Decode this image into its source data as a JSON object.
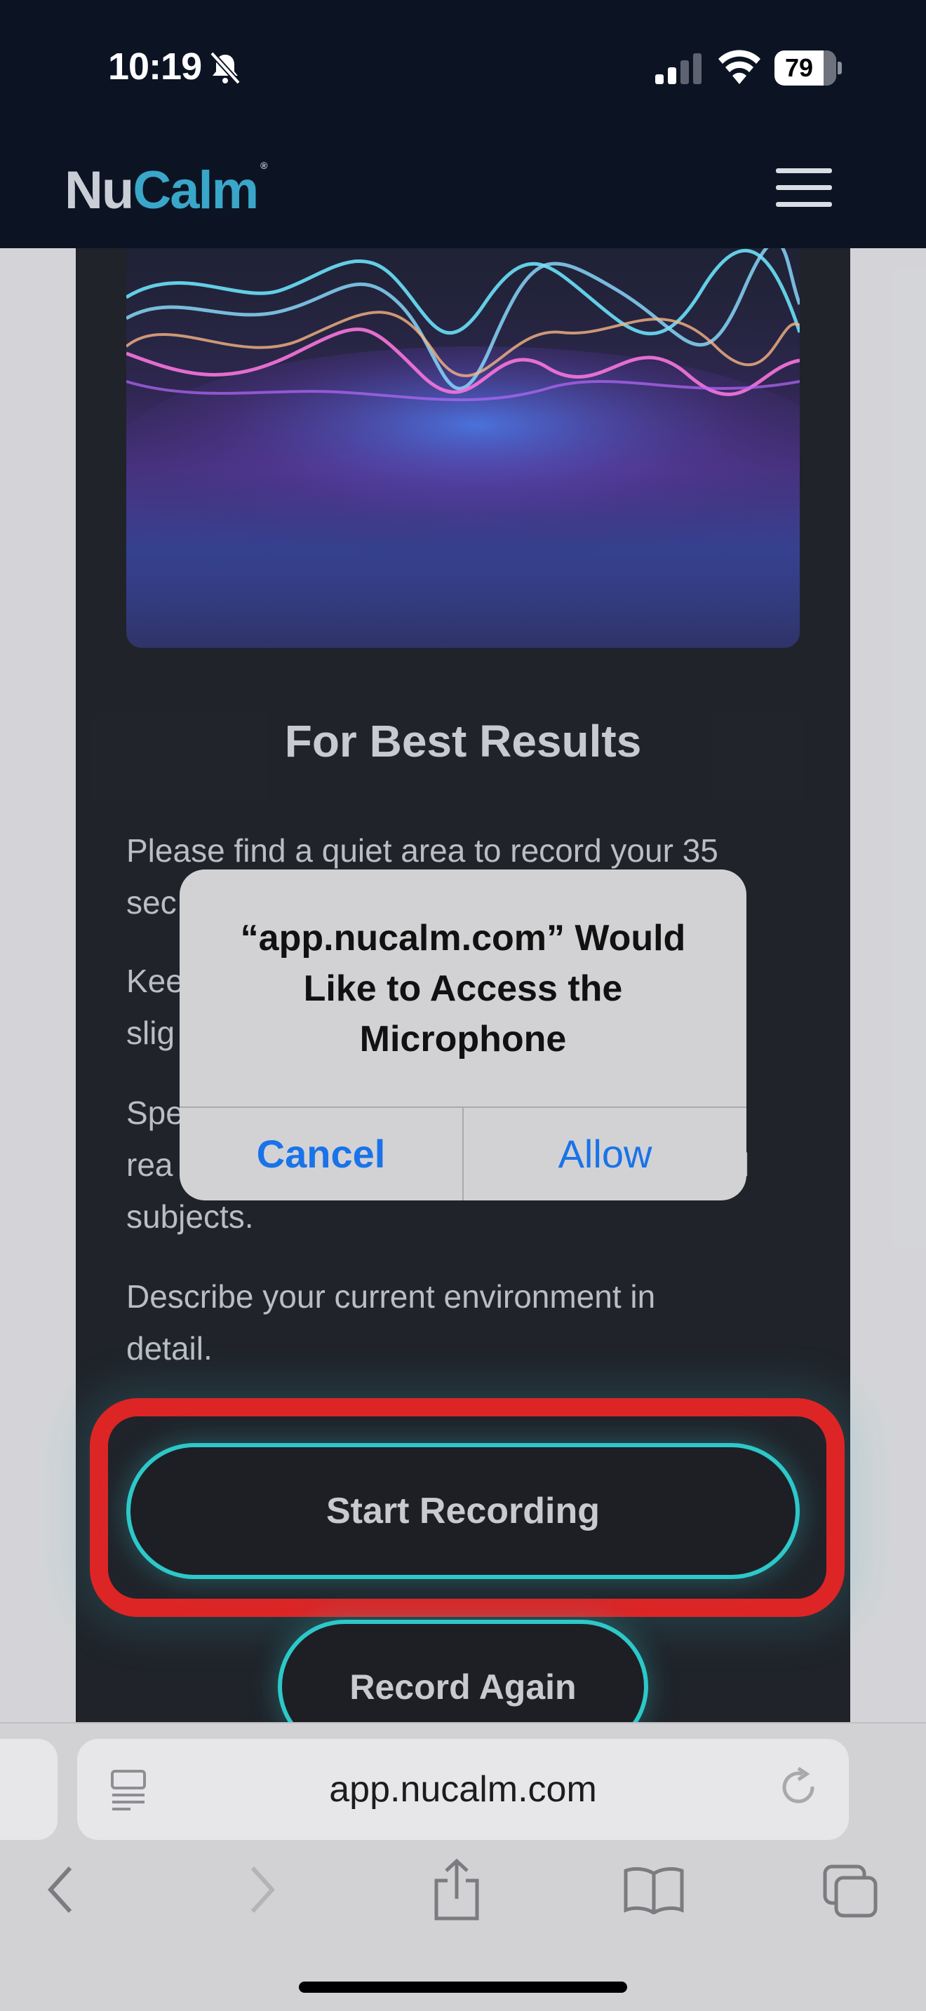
{
  "status_bar": {
    "time": "10:19",
    "battery": "79",
    "battery_level": 0.79
  },
  "site": {
    "logo_part1": "Nu",
    "logo_part2": "Calm",
    "logo_mark": "®"
  },
  "content": {
    "heading": "For Best Results",
    "paragraphs": [
      "Please find a quiet area to record your 35 seconds",
      "Keep your phone slightly",
      "Speak naturally as you read subjects.",
      "Describe your current environment in detail."
    ],
    "para_lines": {
      "p1_line1": "Please find a quiet area to record your 35",
      "p1_line2": "sec",
      "p2_line1": "Kee",
      "p2_line2": "slig",
      "p3_line1": "Spe",
      "p3_line2": "rea",
      "p3_line2_tail": "l",
      "p3_line3": "subjects.",
      "p4_line1": "Describe your current environment in",
      "p4_line2": "detail."
    },
    "start_button": "Start Recording",
    "record_again_button": "Record Again"
  },
  "alert": {
    "title_line1": "“app.nucalm.com” Would",
    "title_line2": "Like to Access the",
    "title_line3": "Microphone",
    "cancel": "Cancel",
    "allow": "Allow"
  },
  "browser": {
    "url": "app.nucalm.com"
  },
  "colors": {
    "header_bg": "#0c1424",
    "accent_teal": "#19c9c9",
    "highlight_red": "#e10f0f",
    "link_blue": "#1a73e8"
  },
  "icons": [
    "bell-slash-icon",
    "signal-icon",
    "wifi-icon",
    "battery-icon",
    "hamburger-menu-icon",
    "reader-icon",
    "reload-icon",
    "back-icon",
    "forward-icon",
    "share-icon",
    "bookmarks-icon",
    "tabs-icon"
  ]
}
